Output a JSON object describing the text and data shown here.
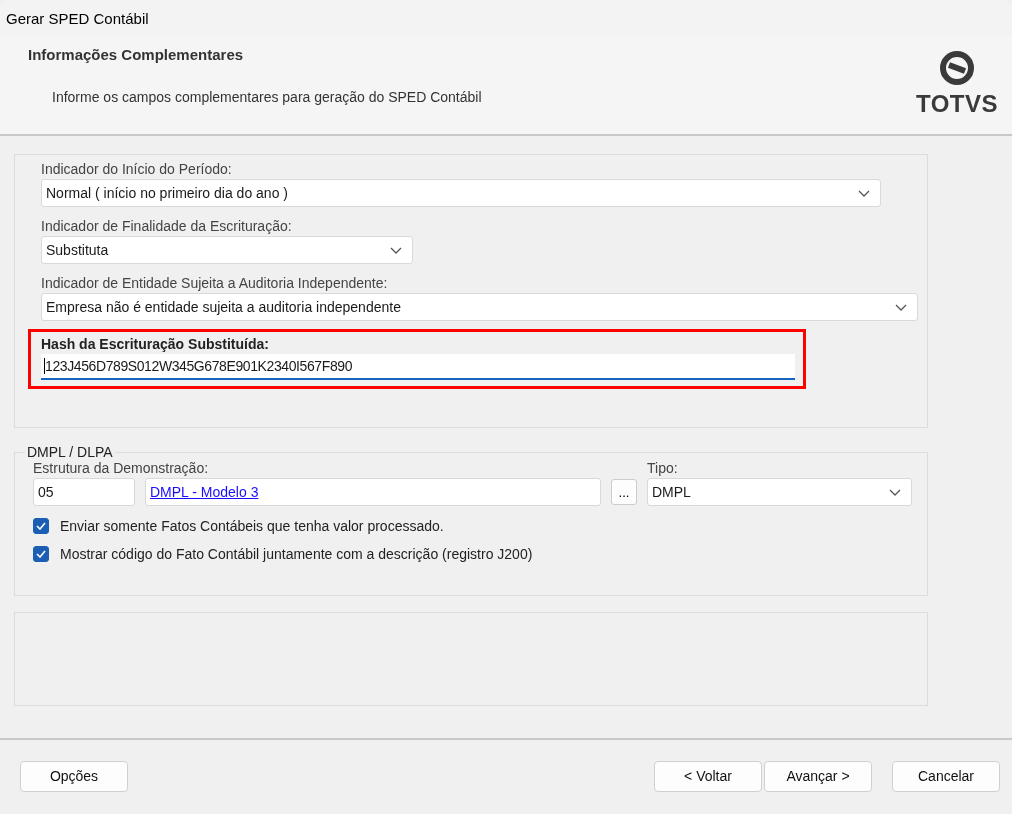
{
  "window": {
    "title": "Gerar SPED Contábil"
  },
  "header": {
    "title": "Informações Complementares",
    "subtitle": "Informe os campos complementares para geração do SPED Contábil",
    "logo_text": "TOTVS"
  },
  "fields": [
    {
      "kind": "select",
      "label": "Indicador do Início do Período:",
      "value": "Normal ( início no primeiro dia do ano )",
      "highlighted": false
    },
    {
      "kind": "select",
      "label": "Indicador de Finalidade da Escrituração:",
      "value": "Substituta",
      "highlighted": false
    },
    {
      "kind": "select",
      "label": "Indicador de Entidade Sujeita a Auditoria Independente:",
      "value": "Empresa não é entidade sujeita a auditoria independente",
      "highlighted": false
    },
    {
      "kind": "text",
      "label": "Hash da Escrituração Substituída:",
      "value": "123J456D789S012W345G678E901K2340I567F890",
      "highlighted": true
    }
  ],
  "dmpl": {
    "title": "DMPL / DLPA",
    "structure_label": "Estrutura da Demonstração:",
    "code": "05",
    "link": "DMPL - Modelo 3",
    "browse": "...",
    "type_label": "Tipo:",
    "type_value": "DMPL",
    "checkboxes": [
      {
        "label": "Enviar somente Fatos Contábeis que tenha valor processado.",
        "checked": true
      },
      {
        "label": "Mostrar código do Fato Contábil  juntamente com a descrição (registro J200)",
        "checked": true
      }
    ]
  },
  "footer": {
    "left_buttons": [
      "Opções"
    ],
    "right_buttons": [
      "< Voltar",
      "Avançar >",
      "Cancelar"
    ]
  }
}
